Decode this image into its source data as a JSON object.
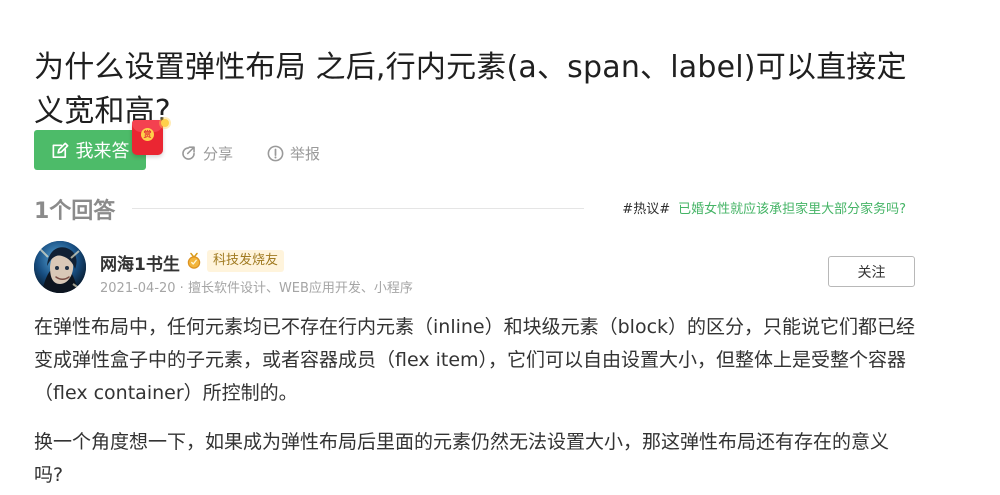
{
  "question": {
    "title": "为什么设置弹性布局 之后,行内元素(a、span、label)可以直接定义宽和高?"
  },
  "actions": {
    "answer_label": "我来答",
    "share_label": "分享",
    "report_label": "举报",
    "red_packet_label": "赏"
  },
  "answers_header": {
    "count_label": "1个回答",
    "hot_topic_tag": "#热议#",
    "hot_topic_question": "已婚女性就应该承担家里大部分家务吗?"
  },
  "answer": {
    "author_name": "网海1书生",
    "author_badge": "科技发烧友",
    "meta": "2021-04-20 · 擅长软件设计、WEB应用开发、小程序",
    "follow_label": "关注",
    "paragraphs": [
      "在弹性布局中，任何元素均已不存在行内元素（inline）和块级元素（block）的区分，只能说它们都已经变成弹性盒子中的子元素，或者容器成员（flex item），它们可以自由设置大小，但整体上是受整个容器（flex container）所控制的。",
      "换一个角度想一下，如果成为弹性布局后里面的元素仍然无法设置大小，那这弹性布局还有存在的意义吗?"
    ]
  },
  "icons": {
    "answer": "edit-icon",
    "share": "share-icon",
    "report": "report-icon",
    "badge": "medal-icon",
    "avatar": "avatar"
  },
  "colors": {
    "answer_button": "#4dbb69",
    "red_packet": "#ea2632",
    "hot_topic_link": "#45b466",
    "muted_text": "#9a9a9a"
  }
}
